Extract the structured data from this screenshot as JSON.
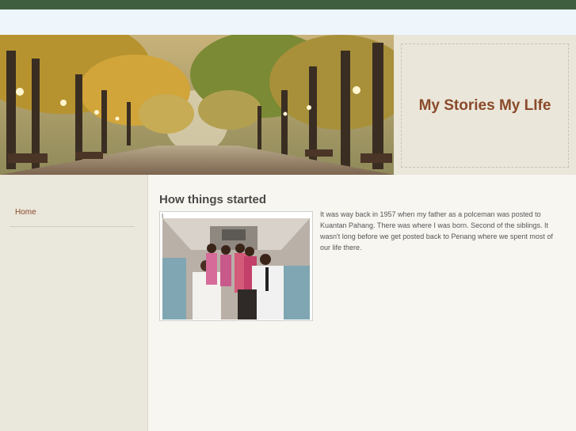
{
  "site": {
    "title": "My Stories My LIfe",
    "banner_image": "tree-lined park path with lamps in autumn"
  },
  "nav": {
    "items": [
      {
        "label": "Home"
      }
    ]
  },
  "post": {
    "title": "How things started",
    "photo_caption": "I",
    "photo_description": "family group posing inside airplane cabin",
    "body": "It was way back in 1957 when my father as a polceman was posted to Kuantan Pahang. There was where I was born. Second of the siblings. It wasn't long before we get posted back to Penang where we spent most of our life there."
  },
  "colors": {
    "top_bar": "#3f5e3f",
    "accent_title": "#8a4a2a",
    "sidebar_bg": "#eae7dc",
    "content_bg": "#f8f6f1"
  }
}
